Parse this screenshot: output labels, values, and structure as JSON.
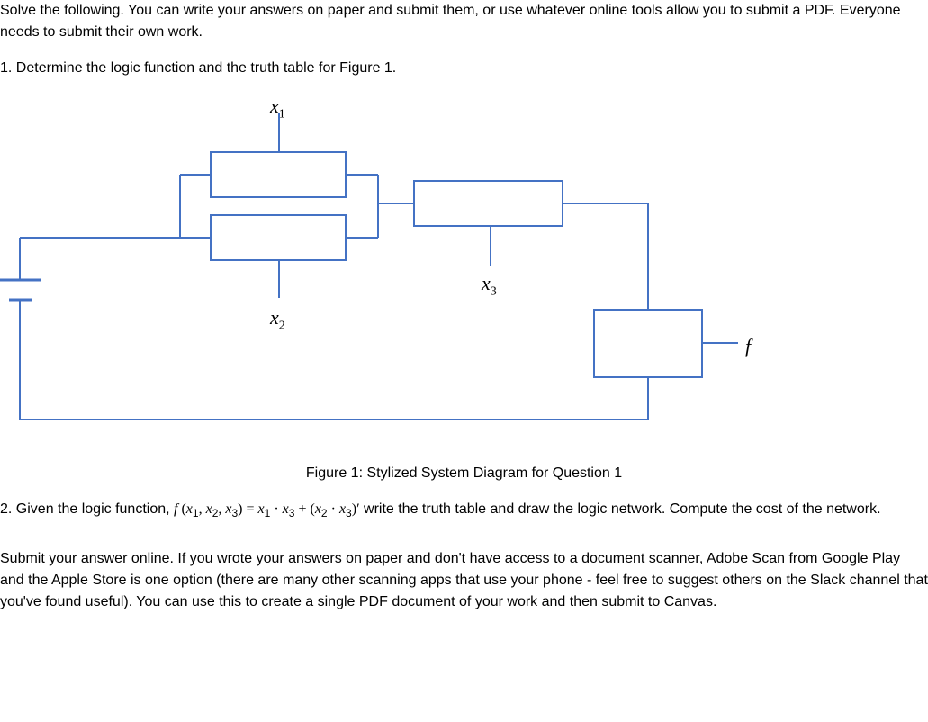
{
  "intro": "Solve the following.  You can write your answers on paper and submit them, or use whatever online tools allow you to submit a PDF.  Everyone needs to submit their own work.",
  "q1": "1.  Determine the logic function and the truth table for Figure 1.",
  "labels": {
    "x1": "x",
    "x1_sub": "1",
    "x2": "x",
    "x2_sub": "2",
    "x3": "x",
    "x3_sub": "3",
    "f": "f"
  },
  "caption": "Figure 1: Stylized System Diagram for Question 1",
  "q2_pre": "2.  Given the logic function, ",
  "q2_func_f": "f ",
  "q2_func_open": "(",
  "q2_x1": "x",
  "q2_x1s": "1",
  "q2_c1": ",  ",
  "q2_x2": "x",
  "q2_x2s": "2",
  "q2_c2": ",  ",
  "q2_x3": "x",
  "q2_x3s": "3",
  "q2_close": ")",
  "q2_eq": " = ",
  "q2_t1a": "x",
  "q2_t1as": "1",
  "q2_dot1": " · ",
  "q2_t1b": "x",
  "q2_t1bs": "3",
  "q2_plus": " + ",
  "q2_p1": "(",
  "q2_t2a": "x",
  "q2_t2as": "2",
  "q2_dot2": " · ",
  "q2_t2b": "x",
  "q2_t2bs": "3",
  "q2_p2": ")",
  "q2_prime": "′",
  "q2_post": " write the truth table and draw the logic network.  Compute the cost of the network.",
  "footer": "Submit your answer online.  If you wrote your answers on paper and don't have access to a document scanner, Adobe Scan from Google Play and the Apple Store is one option (there are many other scanning apps that use your phone - feel free to suggest others on the Slack channel that you've found useful).  You can use this to create a single PDF document of your work and then submit to Canvas."
}
